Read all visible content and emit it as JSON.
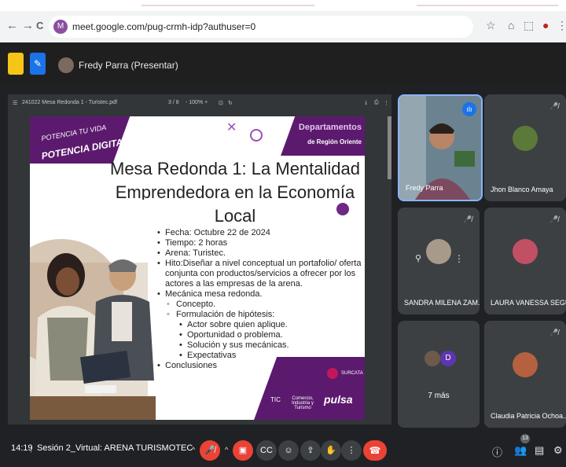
{
  "browser": {
    "url": "meet.google.com/pug-crmh-idp?authuser=0",
    "nav_back": "←",
    "nav_forward": "→",
    "nav_reload": "C",
    "site_icon": "M"
  },
  "meet": {
    "presenter_label": "Fredy Parra (Presentar)"
  },
  "pdf": {
    "filename": "241022 Mesa Redonda 1 - Turistec.pdf",
    "page": "3 / 8",
    "zoom": "- 100% +"
  },
  "slide": {
    "tag_line1": "POTENCIA TU VIDA",
    "tag_line2": "POTENCIA DIGITAL",
    "dep_title": "Departamentos",
    "dep_subtitle": "de Región Oriente",
    "title_line1": "Mesa Redonda 1: La Mentalidad",
    "title_line2": "Emprendedora en la Economía Local",
    "bullets": [
      "Fecha: Octubre 22 de 2024",
      "Tiempo: 2 horas",
      "Arena: Turistec.",
      "Hito:Diseñar a nivel conceptual un portafolio/ oferta conjunta con productos/servicios a ofrecer por los actores a las empresas de la arena.",
      "Mecánica mesa redonda."
    ],
    "sub1": "Concepto.",
    "sub2": "Formulación de hipótesis:",
    "subsub": [
      "Actor sobre quien aplique.",
      "Oportunidad o problema.",
      "Solución y sus mecánicas.",
      "Expectativas"
    ],
    "last_bullet": "Conclusiones",
    "logo_surcata": "SURCATA",
    "logo_tic": "TIC",
    "logo_comercio": "Comercio, Industria y Turismo",
    "logo_pulsa": "pulsa"
  },
  "participants": [
    {
      "name": "Fredy Parra"
    },
    {
      "name": "Jhon Blanco Amaya"
    },
    {
      "name": "SANDRA MILENA ZAM..."
    },
    {
      "name": "LAURA VANESSA SEGU..."
    },
    {
      "name": "7 más",
      "initial": "D"
    },
    {
      "name": "Claudia Patricia Ochoa..."
    }
  ],
  "bottom": {
    "time": "14:19",
    "separator": "|",
    "meeting_name": "Sesión 2_Virtual: ARENA TURISMOTEC",
    "people_count": "13"
  },
  "colors": {
    "brand_purple": "#5c1a6e",
    "end_call_red": "#ea4335",
    "meet_bg": "#202124"
  }
}
